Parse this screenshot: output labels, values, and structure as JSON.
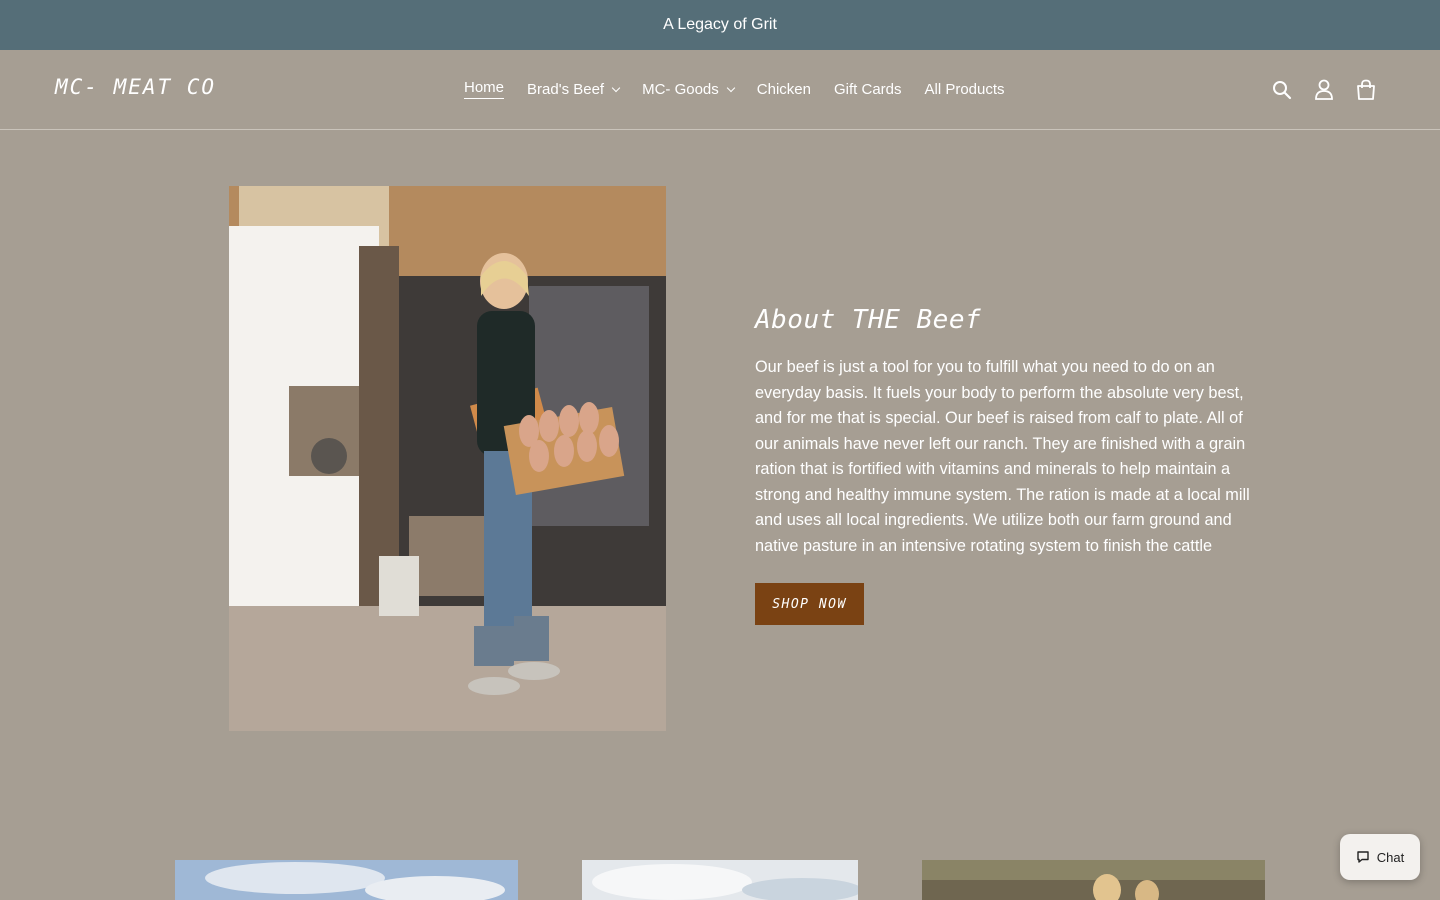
{
  "announcement": "A Legacy of Grit",
  "logo": "MC- MEAT CO",
  "nav": [
    {
      "label": "Home",
      "active": true,
      "dropdown": false
    },
    {
      "label": "Brad's Beef",
      "active": false,
      "dropdown": true
    },
    {
      "label": "MC- Goods",
      "active": false,
      "dropdown": true
    },
    {
      "label": "Chicken",
      "active": false,
      "dropdown": false
    },
    {
      "label": "Gift Cards",
      "active": false,
      "dropdown": false
    },
    {
      "label": "All Products",
      "active": false,
      "dropdown": false
    }
  ],
  "header_icons": [
    "search-icon",
    "account-icon",
    "cart-icon"
  ],
  "about": {
    "title": "About THE Beef",
    "body": "Our beef is just a tool for you to fulfill what you need to do on an everyday basis. It fuels your body to perform the absolute very best, and for me that is special. Our beef is raised from calf to plate. All of our animals have never left our ranch. They are finished with a grain ration that is fortified with vitamins and minerals to help maintain a strong and healthy immune system. The ration is made at a local mill and uses all local ingredients. We utilize both our farm ground and native pasture in an intensive rotating system to finish the cattle",
    "button": "SHOP NOW"
  },
  "chat": {
    "label": "Chat"
  },
  "colors": {
    "background": "#a69e93",
    "announcement_bar": "#556e78",
    "button": "#7a4213"
  }
}
